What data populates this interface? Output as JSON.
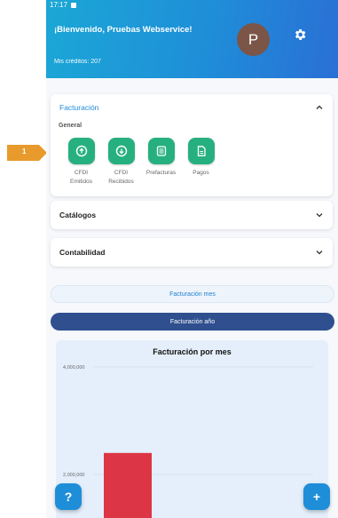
{
  "status": {
    "time": "17:17"
  },
  "header": {
    "welcome": "¡Bienvenido, Pruebas Webservice!",
    "credits": "Mis créditos: 207",
    "avatar_letter": "P"
  },
  "facturacion": {
    "title": "Facturación",
    "section": "General",
    "actions": [
      {
        "label": "CFDI\nEmitidos",
        "icon": "upload-circle-icon"
      },
      {
        "label": "CFDI\nRecibidos",
        "icon": "download-circle-icon"
      },
      {
        "label": "Prefacturas",
        "icon": "list-icon"
      },
      {
        "label": "Pagos",
        "icon": "document-icon"
      }
    ]
  },
  "accordions": {
    "catalogos": "Catálogos",
    "contabilidad": "Contabilidad"
  },
  "toggles": {
    "mes": "Facturación mes",
    "anio": "Facturación año"
  },
  "overlay": {
    "step_badge": "1"
  },
  "fab": {
    "help": "?",
    "add": "+"
  },
  "colors": {
    "primary": "#1f8ed8",
    "accent_green": "#27b07f",
    "bar_red": "#dc3545",
    "dark_blue": "#2f4f8f",
    "badge_orange": "#e89a2c"
  },
  "chart_data": {
    "type": "bar",
    "title": "Facturación por mes",
    "y_ticks": [
      "4,000,000",
      "2,000,000"
    ],
    "ylim": [
      0,
      4000000
    ],
    "series": [
      {
        "values": [
          2400000
        ]
      }
    ],
    "grid": true
  }
}
